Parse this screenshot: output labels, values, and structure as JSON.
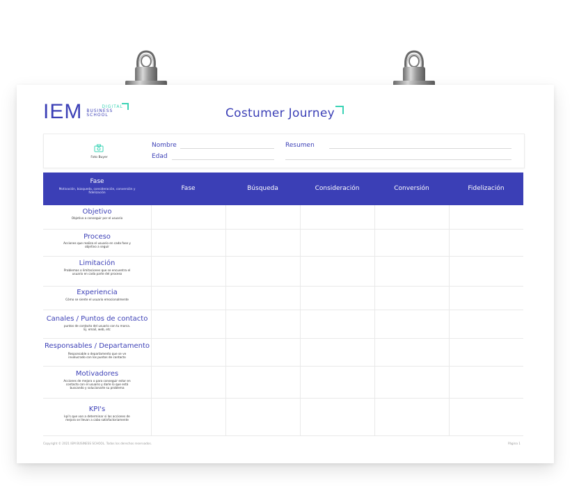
{
  "brand": {
    "logo_text": "IEM",
    "sub_line1": "DIGITAL",
    "sub_line2": "BUSINESS",
    "sub_line3": "SCHOOL"
  },
  "doc_title": "Costumer Journey",
  "persona": {
    "photo_label": "Foto Buyer",
    "name_label": "Nombre",
    "age_label": "Edad",
    "summary_label": "Resumen"
  },
  "table": {
    "header_first_title": "Fase",
    "header_first_sub": "Motivación, búsqueda, consideración, conversión y fidelización",
    "columns": [
      "Fase",
      "Búsqueda",
      "Consideración",
      "Conversión",
      "Fidelización"
    ],
    "rows": [
      {
        "title": "Objetivo",
        "desc": "Objetivo a conseguir por el usuario"
      },
      {
        "title": "Proceso",
        "desc": "Acciones que realiza el usuario en cada fase y objetivo a seguir"
      },
      {
        "title": "Limitación",
        "desc": "Problemas o limitaciones que se encuentra el usuario en cada parte del proceso"
      },
      {
        "title": "Experiencia",
        "desc": "Cómo se siente el usuario emocionalmente"
      },
      {
        "title": "Canales / Puntos de contacto",
        "desc": "puntos de contacto del usuario con tu marca. Ej. email, web, etc"
      },
      {
        "title": "Responsables / Departamento",
        "desc": "Responsable o departamento que se ve involucrado con los puntos de contacto"
      },
      {
        "title": "Motivadores",
        "desc": "Acciones de mejora o para conseguir estar en contacto con el usuario y darle lo que está buscando y solucionarle su problema"
      },
      {
        "title": "KPI's",
        "desc": "kpi's que van a determinar si las acciones de mejora se llevan a cabo satisfactoriamente"
      }
    ]
  },
  "footer": {
    "copyright": "Copyright © 2021 IEM BUSINESS SCHOOL. Todos los derechos reservados.",
    "page": "Página 1"
  },
  "colors": {
    "primary": "#3b3fb6",
    "accent": "#3ad3b5"
  }
}
